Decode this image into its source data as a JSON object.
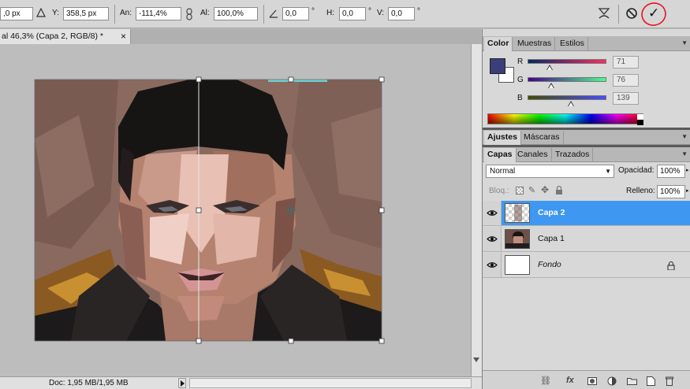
{
  "options_bar": {
    "x_value": ",0 px",
    "y_label": "Y:",
    "y_value": "358,5 px",
    "width_label": "An:",
    "width_value": "-111,4%",
    "height_label": "Al:",
    "height_value": "100,0%",
    "rotate_value": "0,0",
    "rotate_unit": "°",
    "hskew_label": "H:",
    "hskew_value": "0,0",
    "hskew_unit": "°",
    "vskew_label": "V:",
    "vskew_value": "0,0",
    "vskew_unit": "°",
    "commit_glyph": "✓"
  },
  "document": {
    "tab_title": "al 46,3% (Capa 2, RGB/8) *",
    "tab_close": "×"
  },
  "status_bar": {
    "doc_info": "Doc: 1,95 MB/1,95 MB"
  },
  "color_panel": {
    "tabs": [
      "Color",
      "Muestras",
      "Estilos"
    ],
    "foreground_color": "#3a3f7a",
    "background_color": "#ffffff",
    "r_label": "R",
    "r_value": "71",
    "r_fraction": 0.28,
    "g_label": "G",
    "g_value": "76",
    "g_fraction": 0.3,
    "b_label": "B",
    "b_value": "139",
    "b_fraction": 0.55
  },
  "adjust_panel": {
    "tabs": [
      "Ajustes",
      "Máscaras"
    ]
  },
  "layers_panel": {
    "tabs": [
      "Capas",
      "Canales",
      "Trazados"
    ],
    "blend_mode": "Normal",
    "opacity_label": "Opacidad:",
    "opacity_value": "100%",
    "lock_label": "Bloq.:",
    "fill_label": "Relleno:",
    "fill_value": "100%",
    "layers": [
      {
        "name": "Capa 2",
        "selected": true
      },
      {
        "name": "Capa 1",
        "selected": false
      },
      {
        "name": "Fondo",
        "selected": false
      }
    ]
  },
  "icons": [
    "triangle-icon",
    "link-icon",
    "angle-icon",
    "warp-icon",
    "cancel-icon",
    "commit-icon",
    "eye-icon",
    "lock-icon",
    "link-layers-icon",
    "fx-icon",
    "mask-icon",
    "adjustment-icon",
    "folder-icon",
    "new-layer-icon",
    "trash-icon"
  ]
}
